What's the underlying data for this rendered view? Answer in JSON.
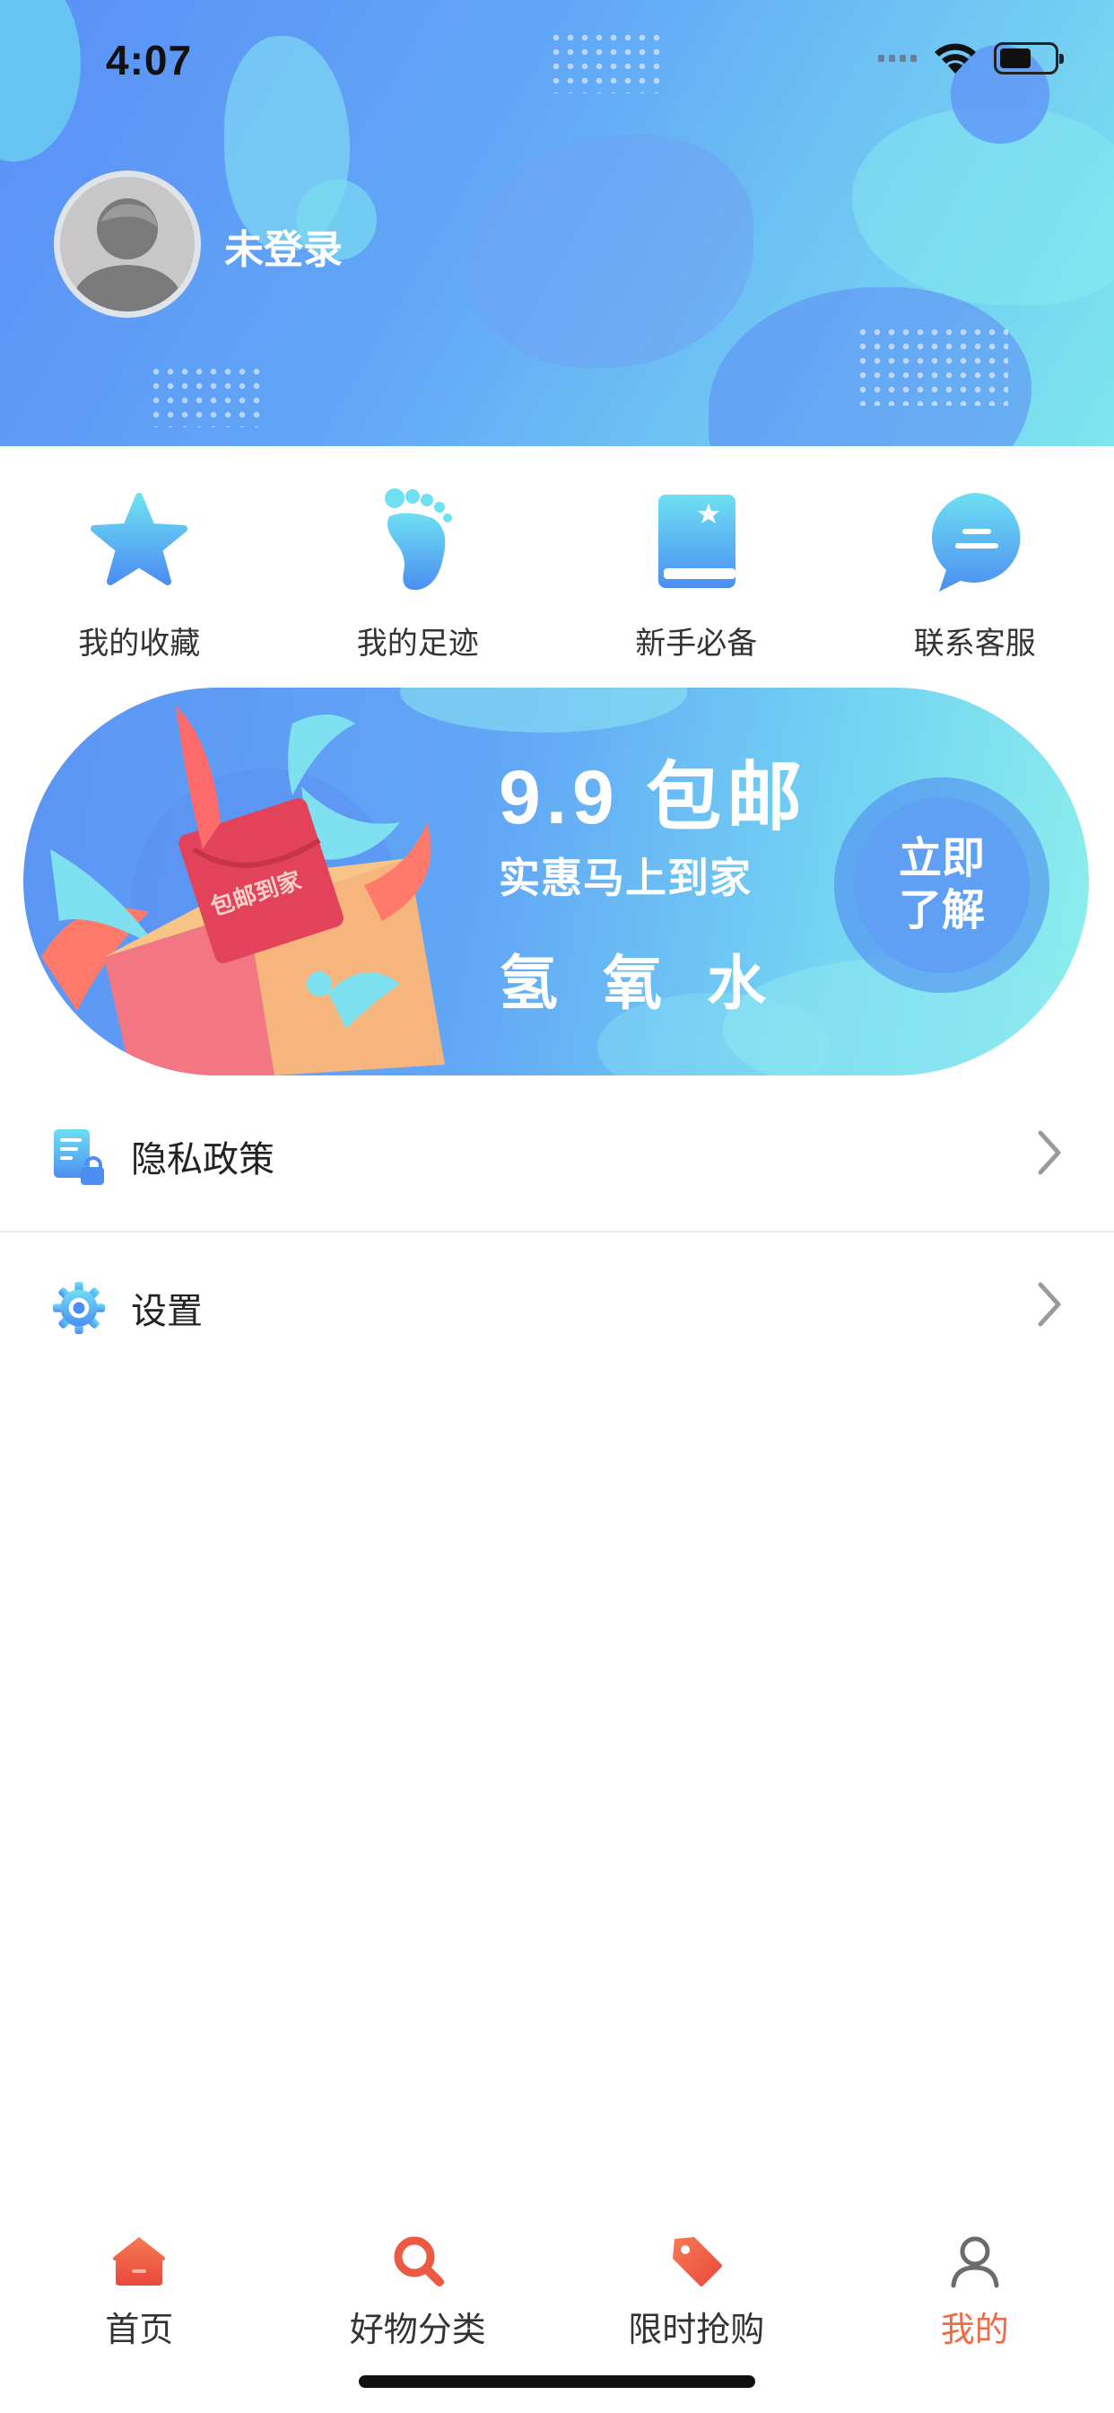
{
  "status_bar": {
    "time": "4:07"
  },
  "profile": {
    "username": "未登录"
  },
  "quick_entries": [
    {
      "label": "我的收藏",
      "icon": "star-icon"
    },
    {
      "label": "我的足迹",
      "icon": "footprint-icon"
    },
    {
      "label": "新手必备",
      "icon": "guide-book-icon"
    },
    {
      "label": "联系客服",
      "icon": "chat-bubble-icon"
    }
  ],
  "banner": {
    "envelope_text": "包邮到家",
    "title": "9.9 包邮",
    "subtitle": "实惠马上到家",
    "product": "氢氧水",
    "button_label": "立即了解"
  },
  "menu": [
    {
      "label": "隐私政策",
      "icon": "privacy-document-icon"
    },
    {
      "label": "设置",
      "icon": "settings-gear-icon"
    }
  ],
  "tabs": [
    {
      "label": "首页",
      "icon": "home-icon",
      "active": false
    },
    {
      "label": "好物分类",
      "icon": "search-icon",
      "active": false
    },
    {
      "label": "限时抢购",
      "icon": "tag-icon",
      "active": false
    },
    {
      "label": "我的",
      "icon": "user-icon",
      "active": true
    }
  ],
  "colors": {
    "accent": "#f06a46",
    "header_start": "#5a8ff7",
    "header_end": "#7ee6ee",
    "icon_blue": "#4f9cf3"
  }
}
